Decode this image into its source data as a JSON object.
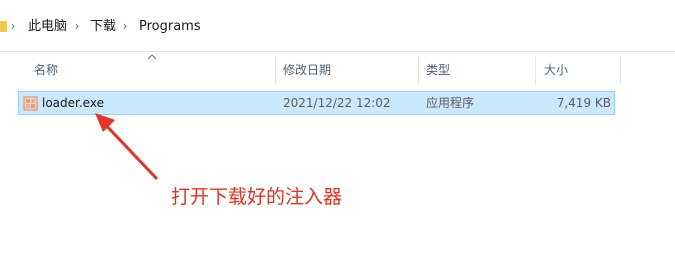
{
  "breadcrumb": {
    "items": [
      "此电脑",
      "下载",
      "Programs"
    ]
  },
  "columns": {
    "name": "名称",
    "modified": "修改日期",
    "type": "类型",
    "size": "大小"
  },
  "files": [
    {
      "name": "loader.exe",
      "modified": "2021/12/22 12:02",
      "type": "应用程序",
      "size": "7,419 KB",
      "selected": true,
      "icon": "exe-file-icon"
    }
  ],
  "annotation": {
    "text": "打开下载好的注入器",
    "color": "#e8321f"
  },
  "colors": {
    "selection_bg": "#cce8ff",
    "selection_border": "#99d1ff"
  }
}
